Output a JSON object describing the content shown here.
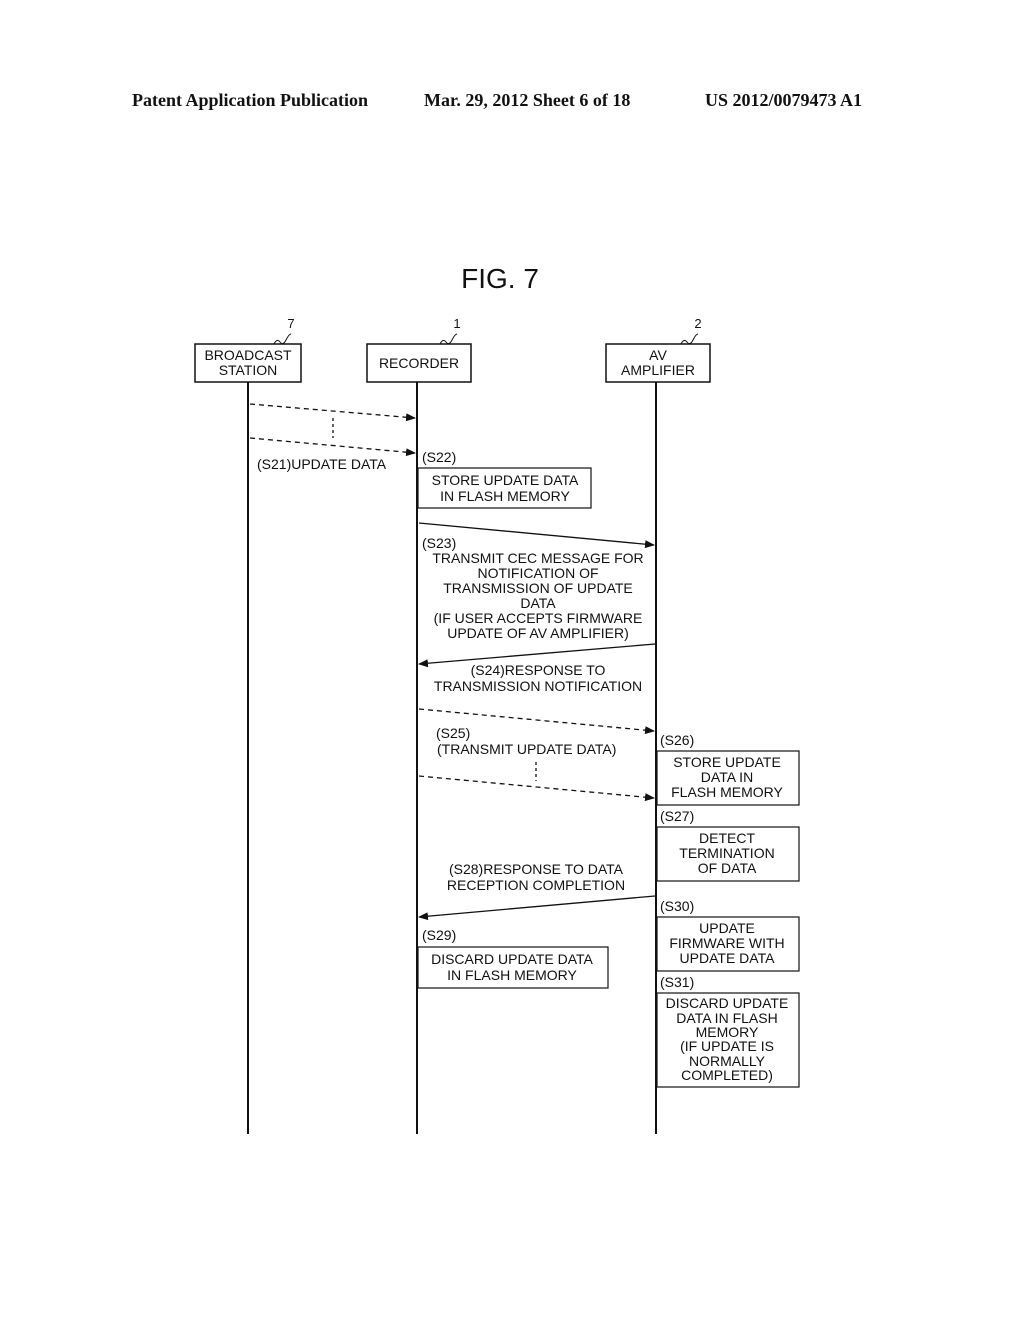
{
  "header": {
    "left": "Patent Application Publication",
    "center": "Mar. 29, 2012  Sheet 6 of 18",
    "right": "US 2012/0079473 A1"
  },
  "figure": {
    "title": "FIG. 7"
  },
  "entities": [
    {
      "ref": "7",
      "lines": [
        "BROADCAST",
        "STATION"
      ]
    },
    {
      "ref": "1",
      "lines": [
        "RECORDER"
      ]
    },
    {
      "ref": "2",
      "lines": [
        "AV",
        "AMPLIFIER"
      ]
    }
  ],
  "steps": {
    "s21": {
      "label": "(S21)UPDATE DATA"
    },
    "s22": {
      "tag": "(S22)",
      "lines": [
        "STORE UPDATE DATA",
        "IN FLASH MEMORY"
      ]
    },
    "s23": {
      "tag": "(S23)",
      "lines": [
        "TRANSMIT CEC MESSAGE FOR",
        "NOTIFICATION OF",
        "TRANSMISSION OF UPDATE",
        "DATA",
        "(IF USER ACCEPTS FIRMWARE",
        "UPDATE OF AV AMPLIFIER)"
      ]
    },
    "s24": {
      "lines": [
        "(S24)RESPONSE TO",
        "TRANSMISSION NOTIFICATION"
      ]
    },
    "s25": {
      "tag": "(S25)",
      "lines": [
        "(TRANSMIT UPDATE DATA)"
      ]
    },
    "s26": {
      "tag": "(S26)",
      "lines": [
        "STORE UPDATE",
        "DATA IN",
        "FLASH MEMORY"
      ]
    },
    "s27": {
      "tag": "(S27)",
      "lines": [
        "DETECT",
        "TERMINATION",
        "OF DATA"
      ]
    },
    "s28": {
      "lines": [
        "(S28)RESPONSE TO DATA",
        "RECEPTION COMPLETION"
      ]
    },
    "s29": {
      "tag": "(S29)",
      "lines": [
        "DISCARD UPDATE DATA",
        "IN FLASH MEMORY"
      ]
    },
    "s30": {
      "tag": "(S30)",
      "lines": [
        "UPDATE",
        "FIRMWARE WITH",
        "UPDATE DATA"
      ]
    },
    "s31": {
      "tag": "(S31)",
      "lines": [
        "DISCARD UPDATE",
        "DATA IN FLASH",
        "MEMORY",
        "(IF UPDATE IS",
        "NORMALLY",
        "COMPLETED)"
      ]
    }
  }
}
